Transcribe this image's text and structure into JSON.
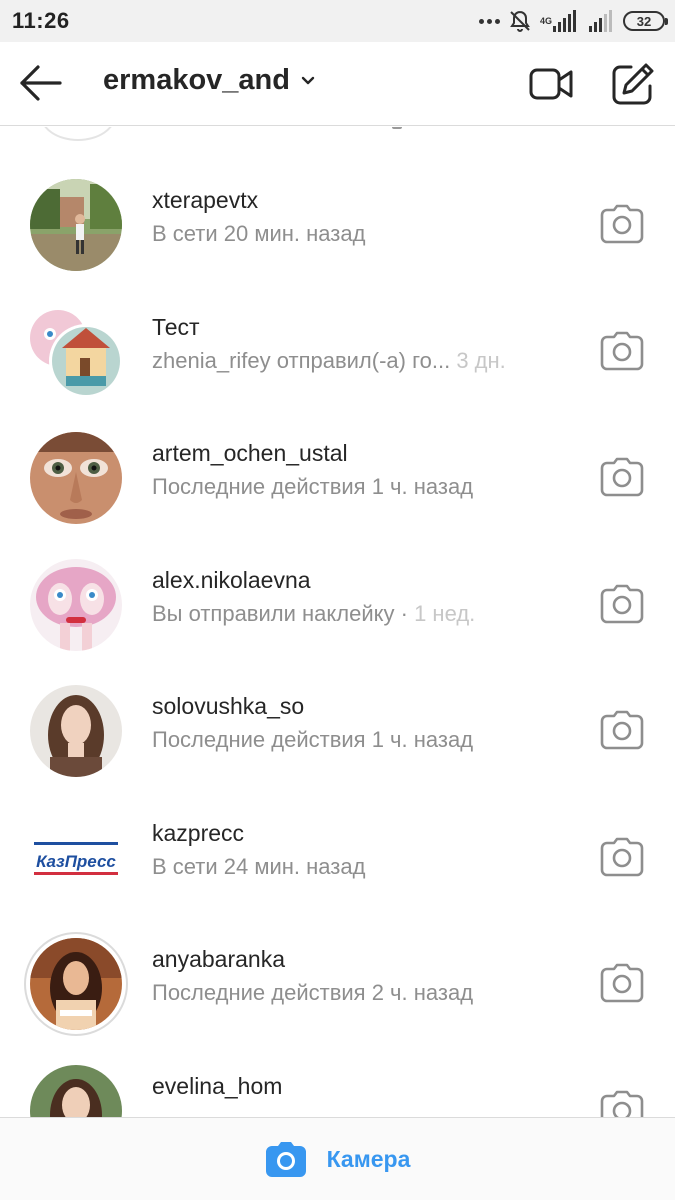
{
  "status_bar": {
    "time": "11:26",
    "network": "4G",
    "battery": "32"
  },
  "header": {
    "title": "ermakov_and"
  },
  "threads": [
    {
      "name": "xterapevtx",
      "status": "В сети 20 мин. назад",
      "time": ""
    },
    {
      "name": "Тест",
      "status": "zhenia_rifey отправил(-а) го...",
      "time": "3 дн."
    },
    {
      "name": "artem_ochen_ustal",
      "status": "Последние действия 1 ч. назад",
      "time": ""
    },
    {
      "name": "alex.nikolaevna",
      "status": "Вы отправили наклейку · ",
      "time": "1 нед."
    },
    {
      "name": "solovushka_so",
      "status": "Последние действия 1 ч. назад",
      "time": ""
    },
    {
      "name": "kazprecc",
      "status": "В сети 24 мин. назад",
      "time": "",
      "logo_text": "КазПресс"
    },
    {
      "name": "anyabaranka",
      "status": "Последние действия 2 ч. назад",
      "time": ""
    },
    {
      "name": "evelina_hom",
      "status": "",
      "time": ""
    }
  ],
  "bottom_bar": {
    "label": "Камера"
  },
  "colors": {
    "accent": "#3897f0",
    "text_primary": "#262626",
    "text_secondary": "#8e8e8e"
  },
  "icons": {
    "back": "arrow-left-icon",
    "dropdown": "chevron-down-icon",
    "video": "video-camera-icon",
    "compose": "compose-icon",
    "row_camera": "camera-icon"
  }
}
